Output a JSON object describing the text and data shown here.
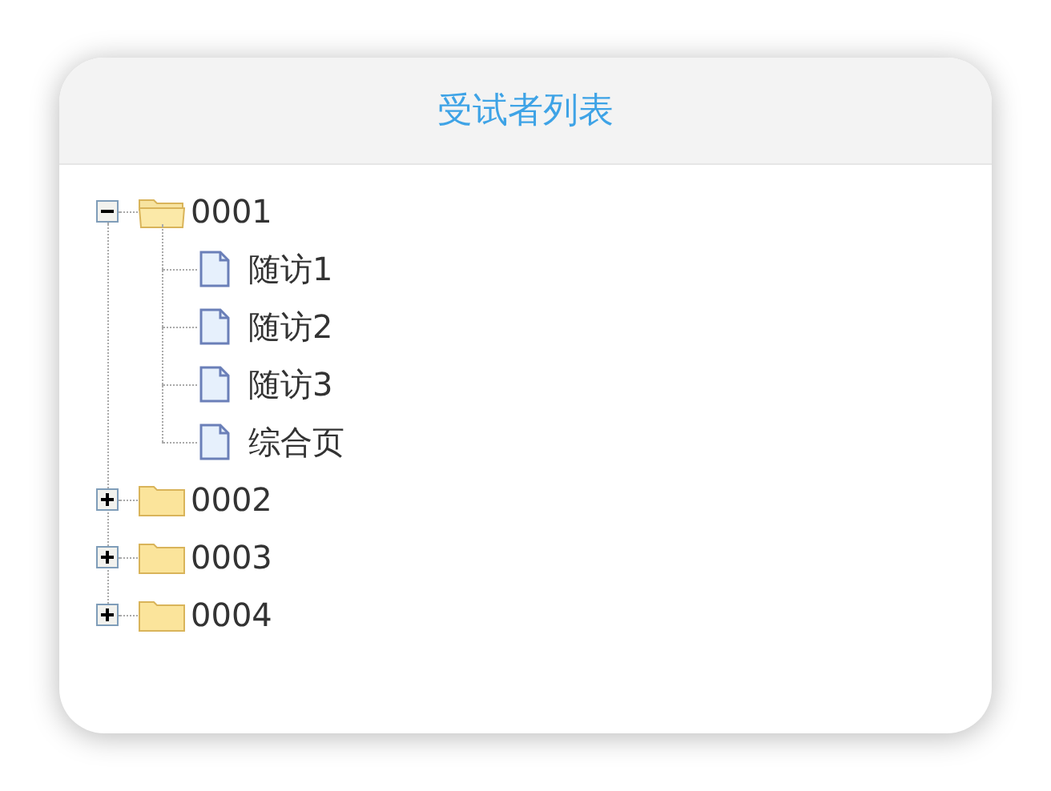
{
  "panel": {
    "title": "受试者列表"
  },
  "tree": [
    {
      "label": "0001",
      "expanded": true,
      "children": [
        {
          "label": "随访1"
        },
        {
          "label": "随访2"
        },
        {
          "label": "随访3"
        },
        {
          "label": "综合页"
        }
      ]
    },
    {
      "label": "0002",
      "expanded": false
    },
    {
      "label": "0003",
      "expanded": false
    },
    {
      "label": "0004",
      "expanded": false
    }
  ]
}
